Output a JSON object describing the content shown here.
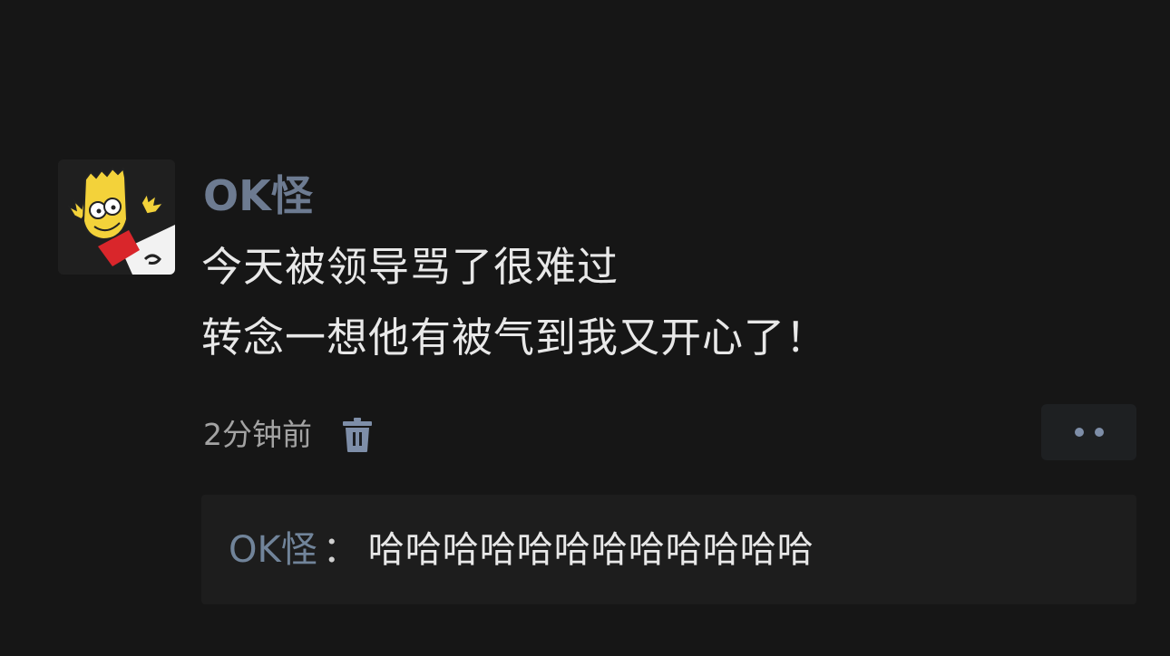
{
  "post": {
    "author": "OK怪",
    "text_lines": [
      "今天被领导骂了很难过",
      "转念一想他有被气到我又开心了！"
    ],
    "timestamp": "2分钟前",
    "avatar_icon": "cartoon-boy-avatar",
    "delete_icon": "trash-icon",
    "more_icon": "more-dots-icon"
  },
  "comments": [
    {
      "author": "OK怪",
      "separator": "：",
      "text": "哈哈哈哈哈哈哈哈哈哈哈哈"
    }
  ],
  "colors": {
    "background": "#161616",
    "author_name": "#6d7b91",
    "body_text": "#e8e8e8",
    "meta_text": "#a3a3a3",
    "accent_icon": "#7e8ea8",
    "comment_box": "#1d1d1d"
  }
}
